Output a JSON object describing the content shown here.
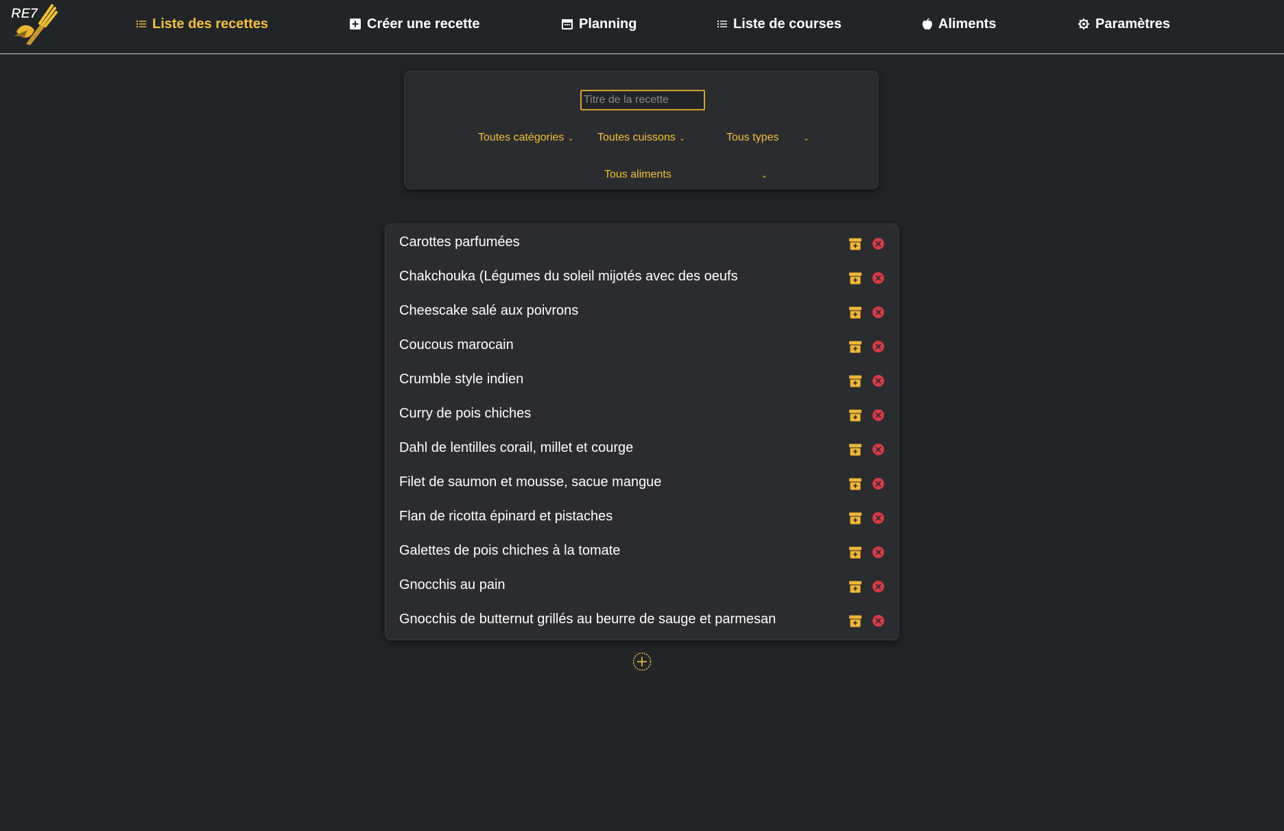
{
  "app": {
    "logo_text": "RE7"
  },
  "nav": {
    "items": [
      {
        "label": "Liste des recettes",
        "icon": "list-icon"
      },
      {
        "label": "Créer une recette",
        "icon": "plus-square-icon"
      },
      {
        "label": "Planning",
        "icon": "calendar-icon"
      },
      {
        "label": "Liste de courses",
        "icon": "list-icon"
      },
      {
        "label": "Aliments",
        "icon": "apple-icon"
      },
      {
        "label": "Paramètres",
        "icon": "gear-icon"
      }
    ],
    "active_index": 0
  },
  "filters": {
    "search_placeholder": "Titre de la recette",
    "search_value": "",
    "category": "Toutes catégories",
    "cooking": "Toutes cuissons",
    "type": "Tous types",
    "food": "Tous aliments"
  },
  "recipes": [
    {
      "title": "Carottes parfumées"
    },
    {
      "title": "Chakchouka (Légumes du soleil mijotés avec des oeufs"
    },
    {
      "title": "Cheescake salé aux poivrons"
    },
    {
      "title": "Coucous marocain"
    },
    {
      "title": "Crumble style indien"
    },
    {
      "title": "Curry de pois chiches"
    },
    {
      "title": "Dahl de lentilles corail, millet et courge"
    },
    {
      "title": "Filet de saumon et mousse, sacue mangue"
    },
    {
      "title": "Flan de ricotta épinard et pistaches"
    },
    {
      "title": "Galettes de pois chiches à la tomate"
    },
    {
      "title": "Gnocchis au pain"
    },
    {
      "title": "Gnocchis de butternut grillés au beurre de sauge et parmesan"
    }
  ],
  "row_icons": {
    "archive": "archive-icon",
    "delete": "close-circle-icon"
  },
  "colors": {
    "background": "#222528",
    "panel": "#2b2c2f",
    "accent": "#f7c13a",
    "danger": "#d93a45",
    "text": "#ffffff"
  }
}
